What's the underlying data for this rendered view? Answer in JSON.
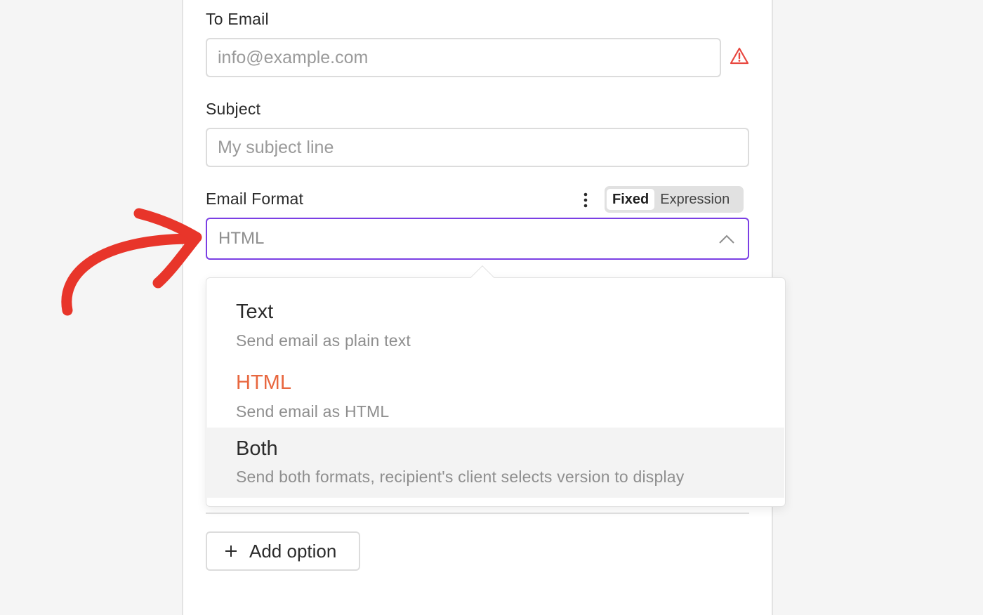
{
  "to_email": {
    "label": "To Email",
    "placeholder": "info@example.com",
    "value": "",
    "status_icon": "warning-triangle-icon",
    "status_color": "#e8473f"
  },
  "subject": {
    "label": "Subject",
    "placeholder": "My subject line",
    "value": ""
  },
  "email_format": {
    "label": "Email Format",
    "options_menu_icon": "vertical-dots-icon",
    "mode_toggle": {
      "fixed_label": "Fixed",
      "expression_label": "Expression",
      "active": "Fixed"
    },
    "selected_value": "HTML",
    "chevron_icon": "chevron-up-icon",
    "focus_color": "#7b3fe4",
    "dropdown": {
      "options": [
        {
          "title": "Text",
          "description": "Send email as plain text"
        },
        {
          "title": "HTML",
          "description": "Send email as HTML",
          "selected": true
        },
        {
          "title": "Both",
          "description": "Send both formats, recipient's client selects version to display",
          "hovered": true
        }
      ],
      "selected_color": "#e8673f"
    }
  },
  "add_option": {
    "icon": "plus-icon",
    "label": "Add option"
  },
  "annotation": {
    "icon": "curved-arrow-annotation",
    "color": "#e8352a"
  }
}
